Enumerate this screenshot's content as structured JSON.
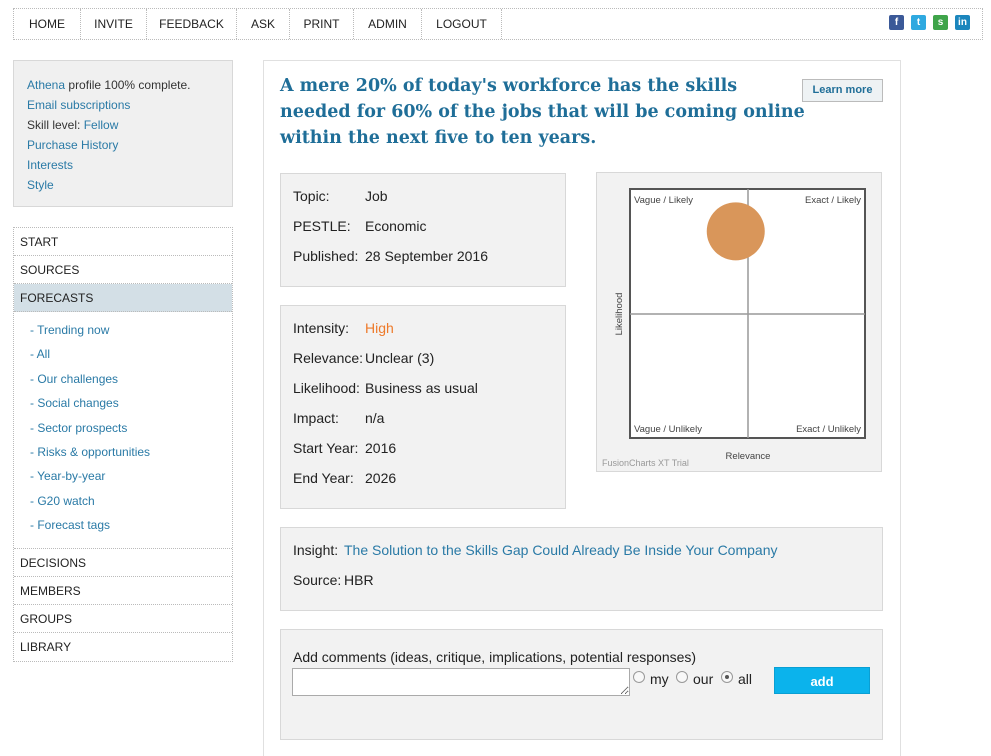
{
  "nav": {
    "items": [
      "HOME",
      "INVITE",
      "FEEDBACK",
      "ASK",
      "PRINT",
      "ADMIN",
      "LOGOUT"
    ],
    "social": [
      "facebook-icon",
      "twitter-icon",
      "stumbleupon-icon",
      "linkedin-icon"
    ]
  },
  "profile": {
    "name": "Athena",
    "complete": "profile 100% complete.",
    "email_subscriptions": "Email subscriptions",
    "skill_label": "Skill level:",
    "skill_value": "Fellow",
    "purchase_history": "Purchase History",
    "interests": "Interests",
    "style": "Style"
  },
  "sidebar": {
    "top": [
      "START",
      "SOURCES",
      "FORECASTS"
    ],
    "forecasts_sub": [
      "- Trending now",
      "- All",
      "- Our challenges",
      "- Social changes",
      "- Sector prospects",
      "- Risks & opportunities",
      "- Year-by-year",
      "- G20 watch",
      "- Forecast tags"
    ],
    "bottom": [
      "DECISIONS",
      "MEMBERS",
      "GROUPS",
      "LIBRARY"
    ]
  },
  "headline": "A mere 20% of today's workforce has the skills needed for 60% of the jobs that will be coming online within the next five to ten years.",
  "learn_more": "Learn more",
  "meta": {
    "topic_label": "Topic:",
    "topic": "Job",
    "pestle_label": "PESTLE:",
    "pestle": "Economic",
    "published_label": "Published:",
    "published": "28 September 2016"
  },
  "assessment": {
    "intensity_label": "Intensity:",
    "intensity": "High",
    "relevance_label": "Relevance:",
    "relevance": "Unclear (3)",
    "likelihood_label": "Likelihood:",
    "likelihood": "Business as usual",
    "impact_label": "Impact:",
    "impact": "n/a",
    "start_label": "Start Year:",
    "start": "2016",
    "end_label": "End Year:",
    "end": "2026"
  },
  "insight": {
    "label": "Insight:",
    "title": "The Solution to the Skills Gap Could Already Be Inside Your Company",
    "source_label": "Source:",
    "source": "HBR"
  },
  "comments": {
    "label": "Add comments (ideas, critique, implications, potential responses)",
    "options": [
      "my",
      "our",
      "all"
    ],
    "selected": "all",
    "add": "add"
  },
  "chart_data": {
    "type": "scatter",
    "quadrants": [
      "Vague / Likely",
      "Exact / Likely",
      "Vague / Unlikely",
      "Exact / Unlikely"
    ],
    "xlabel": "Relevance",
    "ylabel": "Likelihood",
    "credit": "FusionCharts XT Trial",
    "xlim": [
      0,
      1
    ],
    "ylim": [
      0,
      1
    ],
    "points": [
      {
        "x": 0.45,
        "y": 0.83
      }
    ],
    "bubble_color": "#d9965a"
  }
}
